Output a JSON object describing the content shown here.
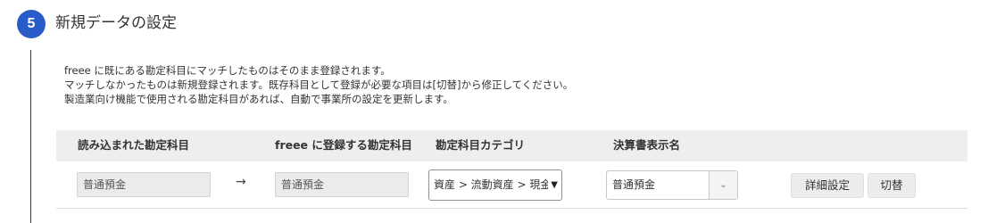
{
  "step": {
    "number": "5",
    "title": "新規データの設定"
  },
  "description": [
    "freee に既にある勘定科目にマッチしたものはそのまま登録されます。",
    "マッチしなかったものは新規登録されます。既存科目として登録が必要な項目は[切替]から修正してください。",
    "製造業向け機能で使用される勘定科目があれば、自動で事業所の設定を更新します。"
  ],
  "table": {
    "headers": {
      "imported": "読み込まれた勘定科目",
      "freee": "freee に登録する勘定科目",
      "category": "勘定科目カテゴリ",
      "display_name": "決算書表示名"
    },
    "rows": [
      {
        "imported": "普通預金",
        "arrow": "→",
        "freee": "普通預金",
        "category": "資産 > 流動資産 > 現金",
        "display_name": "普通預金",
        "detail_button": "詳細設定",
        "switch_button": "切替"
      }
    ]
  },
  "icons": {
    "select_chevron": "chevron-down-icon",
    "combo_chevron": "chevron-down-icon",
    "arrow": "arrow-right-icon"
  },
  "colors": {
    "accent": "#2a5cc9",
    "header_bg": "#eeeeee",
    "button_bg": "#ececec"
  }
}
